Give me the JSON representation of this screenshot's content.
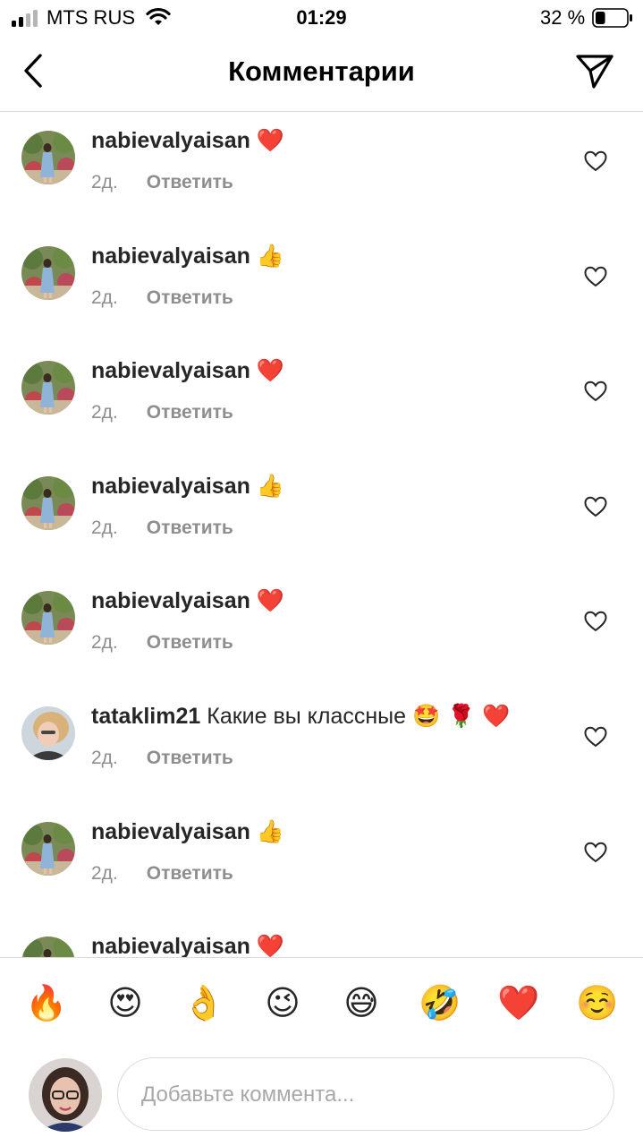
{
  "status_bar": {
    "carrier": "MTS RUS",
    "time": "01:29",
    "battery_percent": "32 %",
    "battery_level": 0.32
  },
  "header": {
    "title": "Комментарии",
    "back_icon": "chevron-left-icon",
    "share_icon": "paper-plane-icon"
  },
  "comments": [
    {
      "username": "nabievalyaisan",
      "text": "",
      "emoji": "❤️",
      "time": "2д.",
      "reply_label": "Ответить",
      "avatar": "user-avatar-1"
    },
    {
      "username": "nabievalyaisan",
      "text": "",
      "emoji": "👍",
      "time": "2д.",
      "reply_label": "Ответить",
      "avatar": "user-avatar-1"
    },
    {
      "username": "nabievalyaisan",
      "text": "",
      "emoji": "❤️",
      "time": "2д.",
      "reply_label": "Ответить",
      "avatar": "user-avatar-1"
    },
    {
      "username": "nabievalyaisan",
      "text": "",
      "emoji": "👍",
      "time": "2д.",
      "reply_label": "Ответить",
      "avatar": "user-avatar-1"
    },
    {
      "username": "nabievalyaisan",
      "text": "",
      "emoji": "❤️",
      "time": "2д.",
      "reply_label": "Ответить",
      "avatar": "user-avatar-1"
    },
    {
      "username": "tataklim21",
      "text": "Какие вы классные",
      "emoji": "🤩 🌹 ❤️",
      "time": "2д.",
      "reply_label": "Ответить",
      "avatar": "user-avatar-2"
    },
    {
      "username": "nabievalyaisan",
      "text": "",
      "emoji": "👍",
      "time": "2д.",
      "reply_label": "Ответить",
      "avatar": "user-avatar-1"
    },
    {
      "username": "nabievalyaisan",
      "text": "",
      "emoji": "❤️",
      "time": "",
      "reply_label": "",
      "avatar": "user-avatar-1"
    }
  ],
  "emoji_bar": [
    "🔥",
    "😍",
    "👌",
    "😉",
    "😅",
    "🤣",
    "❤️",
    "☺️"
  ],
  "input": {
    "placeholder": "Добавьте коммента...",
    "value": ""
  },
  "colors": {
    "text": "#262626",
    "secondary": "#8e8e8e",
    "divider": "#dbdbdb",
    "heart": "#ed1c24"
  }
}
